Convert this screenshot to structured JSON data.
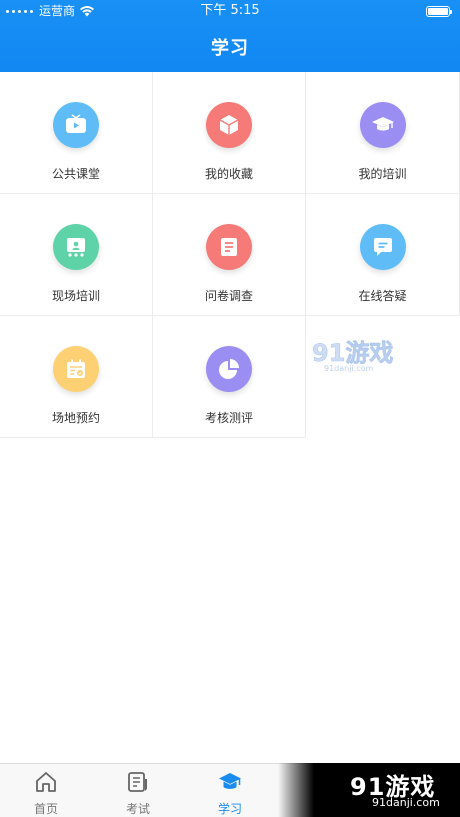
{
  "status": {
    "carrier": "运营商",
    "time": "下午 5:15"
  },
  "nav": {
    "title": "学习"
  },
  "grid": {
    "items": [
      {
        "label": "公共课堂",
        "color": "#5fbcf7",
        "icon": "tv-icon"
      },
      {
        "label": "我的收藏",
        "color": "#f57a78",
        "icon": "box-icon"
      },
      {
        "label": "我的培训",
        "color": "#9b8ef3",
        "icon": "graduation-cap-icon"
      },
      {
        "label": "现场培训",
        "color": "#5ed3a8",
        "icon": "classroom-icon"
      },
      {
        "label": "问卷调查",
        "color": "#f57a78",
        "icon": "document-icon"
      },
      {
        "label": "在线答疑",
        "color": "#5fbcf7",
        "icon": "chat-icon"
      },
      {
        "label": "场地预约",
        "color": "#fdd074",
        "icon": "calendar-icon"
      },
      {
        "label": "考核测评",
        "color": "#9b8ef3",
        "icon": "pie-chart-icon"
      }
    ]
  },
  "watermark": {
    "text": "91游戏",
    "url": "91danji.com"
  },
  "tabbar": {
    "tabs": [
      {
        "label": "首页",
        "icon": "home-icon"
      },
      {
        "label": "考试",
        "icon": "exam-icon"
      },
      {
        "label": "学习",
        "icon": "graduation-cap-icon"
      }
    ],
    "active_color": "#1a8cf0"
  },
  "ad": {
    "title": "91游戏",
    "url": "91danji.com"
  }
}
